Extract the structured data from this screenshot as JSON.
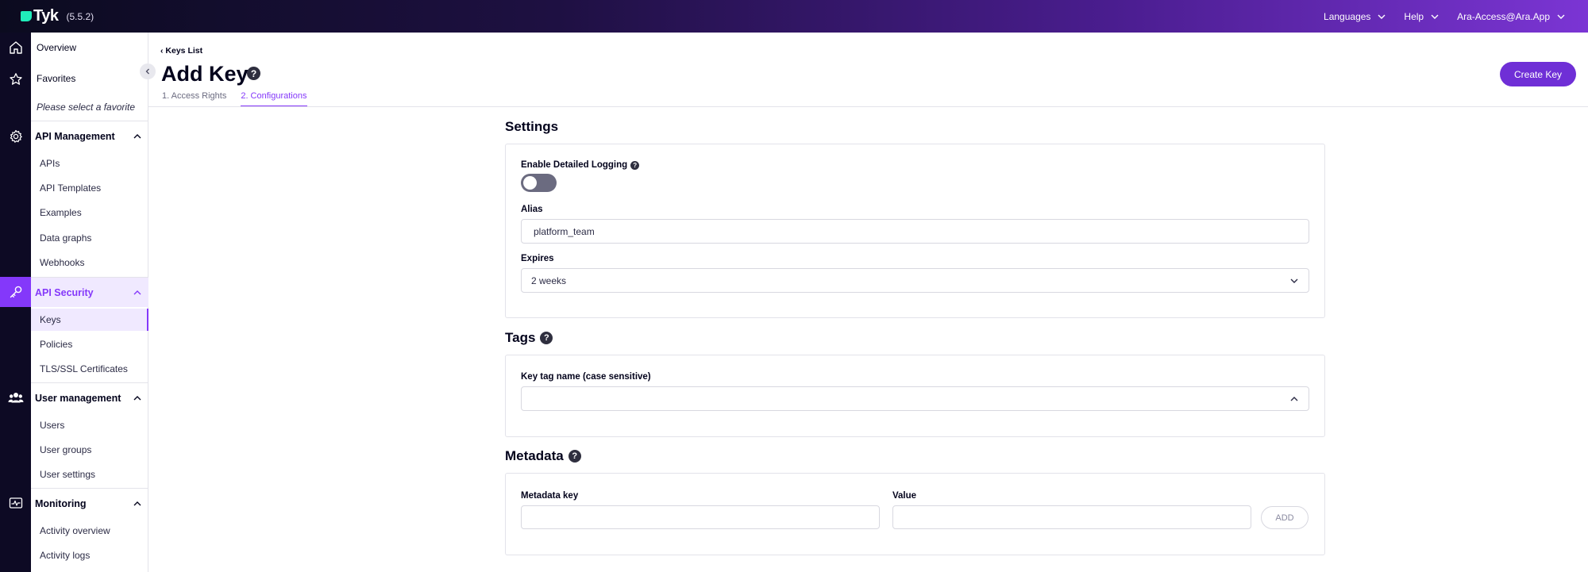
{
  "app": {
    "name": "Tyk",
    "version": "(5.5.2)"
  },
  "top_menu": {
    "languages": "Languages",
    "help": "Help",
    "account": "Ara-Access@Ara.App"
  },
  "sidebar": {
    "overview": "Overview",
    "favorites": "Favorites",
    "favorites_hint": "Please select a favorite",
    "sections": [
      {
        "label": "API Management",
        "items": [
          "APIs",
          "API Templates",
          "Examples",
          "Data graphs",
          "Webhooks"
        ]
      },
      {
        "label": "API Security",
        "items": [
          "Keys",
          "Policies",
          "TLS/SSL Certificates"
        ]
      },
      {
        "label": "User management",
        "items": [
          "Users",
          "User groups",
          "User settings"
        ]
      },
      {
        "label": "Monitoring",
        "items": [
          "Activity overview",
          "Activity logs"
        ]
      }
    ],
    "active_item": "Keys"
  },
  "header": {
    "breadcrumb": "Keys List",
    "title": "Add Key",
    "help_glyph": "?",
    "tabs": [
      "1. Access Rights",
      "2. Configurations"
    ],
    "active_tab": 1,
    "create_button": "Create Key"
  },
  "settings": {
    "title": "Settings",
    "logging_label": "Enable Detailed Logging",
    "logging_enabled": false,
    "alias_label": "Alias",
    "alias_value": "platform_team",
    "expires_label": "Expires",
    "expires_value": "2 weeks"
  },
  "tags": {
    "title": "Tags",
    "field_label": "Key tag name (case sensitive)",
    "field_value": ""
  },
  "metadata": {
    "title": "Metadata",
    "key_label": "Metadata key",
    "value_label": "Value",
    "key_value": "",
    "value_value": "",
    "add_button": "ADD"
  },
  "colors": {
    "accent": "#8438fa",
    "button": "#6f2fd6",
    "rail": "#0d0a24"
  }
}
